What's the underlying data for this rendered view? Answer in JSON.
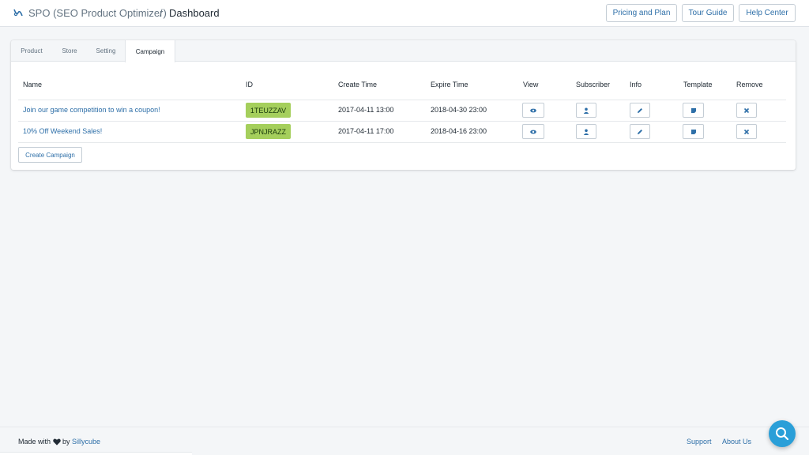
{
  "header": {
    "app_title": "SPO (SEO Product Optimizer)",
    "separator": "/",
    "current_page": "Dashboard",
    "buttons": {
      "pricing": "Pricing and Plan",
      "tour": "Tour Guide",
      "help": "Help Center"
    }
  },
  "tabs": [
    {
      "label": "Product"
    },
    {
      "label": "Store"
    },
    {
      "label": "Setting"
    },
    {
      "label": "Campaign",
      "active": true
    }
  ],
  "table": {
    "columns": [
      "Name",
      "ID",
      "Create Time",
      "Expire Time",
      "View",
      "Subscriber",
      "Info",
      "Template",
      "Remove"
    ],
    "rows": [
      {
        "name": "Join our game competition to win a coupon!",
        "id": "1TEUZZAV",
        "create_time": "2017-04-11 13:00",
        "expire_time": "2018-04-30 23:00"
      },
      {
        "name": "10% Off Weekend Sales!",
        "id": "JPNJRAZZ",
        "create_time": "2017-04-11 17:00",
        "expire_time": "2018-04-16 23:00"
      }
    ],
    "action_icons": [
      "eye-icon",
      "user-icon",
      "pencil-icon",
      "template-icon",
      "close-icon"
    ]
  },
  "create_button": "Create Campaign",
  "footer": {
    "made_with": "Made with",
    "by": "by",
    "company": "Sillycube",
    "links": {
      "support": "Support",
      "about": "About Us"
    }
  },
  "colors": {
    "link": "#2e6fa8",
    "badge": "#a5cf5c",
    "fab": "#2a9fd8",
    "background": "#f4f6f8"
  }
}
